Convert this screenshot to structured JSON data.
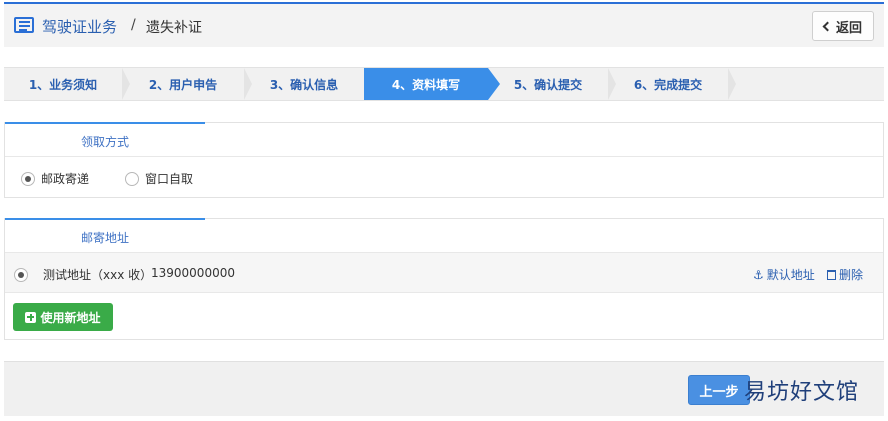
{
  "header": {
    "title": "驾驶证业务",
    "separator": "/",
    "subtitle": "遗失补证",
    "back_label": "返回"
  },
  "steps": [
    {
      "label": "1、业务须知",
      "active": false
    },
    {
      "label": "2、用户申告",
      "active": false
    },
    {
      "label": "3、确认信息",
      "active": false
    },
    {
      "label": "4、资料填写",
      "active": true
    },
    {
      "label": "5、确认提交",
      "active": false
    },
    {
      "label": "6、完成提交",
      "active": false
    }
  ],
  "pickup": {
    "title": "领取方式",
    "options": [
      {
        "label": "邮政寄递",
        "selected": true
      },
      {
        "label": "窗口自取",
        "selected": false
      }
    ]
  },
  "mailing": {
    "title": "邮寄地址",
    "address": {
      "label": "测试地址（xxx 收）",
      "phone": "13900000000",
      "selected": true
    },
    "default_label": "默认地址",
    "delete_label": "删除",
    "new_address_label": "使用新地址"
  },
  "footer": {
    "prev_label": "上一步",
    "watermark": "易坊好文馆"
  },
  "colors": {
    "accent": "#3a8ee8",
    "link": "#2a5fb0",
    "green": "#3aab48"
  }
}
